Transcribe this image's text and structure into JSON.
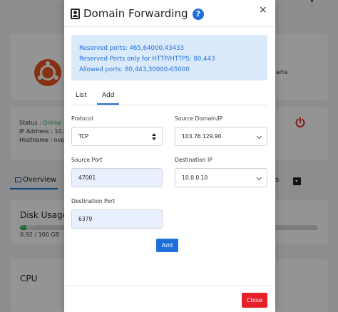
{
  "background": {
    "vps_name_partial": "arta",
    "status_label": "Status :",
    "status_value": "Online",
    "ip_label": "IP Address : 10.0.",
    "hostname_label": "Hostname : nvps",
    "tabs": {
      "overview": "Overview",
      "other_partial": "s"
    },
    "disk": {
      "heading": "Disk Usage",
      "percent_label": "0.92 %",
      "usage_text": "0.92 / 100 GB",
      "percent": 0.92
    },
    "cpu_heading": "CPU",
    "colors": {
      "ubuntu": "#e95420",
      "online": "#1aa34a",
      "power": "#d9312b",
      "disk_fill": "#2db353"
    }
  },
  "modal": {
    "title": "Domain Forwarding",
    "icons": {
      "title": "id-card-icon",
      "help": "question-circle-icon",
      "close": "close-icon"
    },
    "help_glyph": "?",
    "close_glyph": "×",
    "info": {
      "line1": "Reserved ports: 465,64000,43433",
      "line2": "Reserved Ports only for HTTP/HTTPS: 80,443",
      "line3": "Allowed ports: 80,443,30000-65000"
    },
    "tabs": {
      "list": "List",
      "add": "Add",
      "active": "Add"
    },
    "form": {
      "protocol": {
        "label": "Protocol",
        "value": "TCP"
      },
      "source_domain": {
        "label": "Source Domain/IP",
        "value": "103.76.129.90"
      },
      "source_port": {
        "label": "Source Port",
        "value": "47001"
      },
      "destination_ip": {
        "label": "Destination IP",
        "value": "10.0.0.10"
      },
      "destination_port": {
        "label": "Destination Port",
        "value": "6379"
      }
    },
    "add_button": "Add",
    "close_button": "Close",
    "colors": {
      "primary": "#1e6fd9",
      "danger": "#e8202a",
      "info_bg": "#dbeafb",
      "filled_input": "#e8f0fe"
    }
  }
}
